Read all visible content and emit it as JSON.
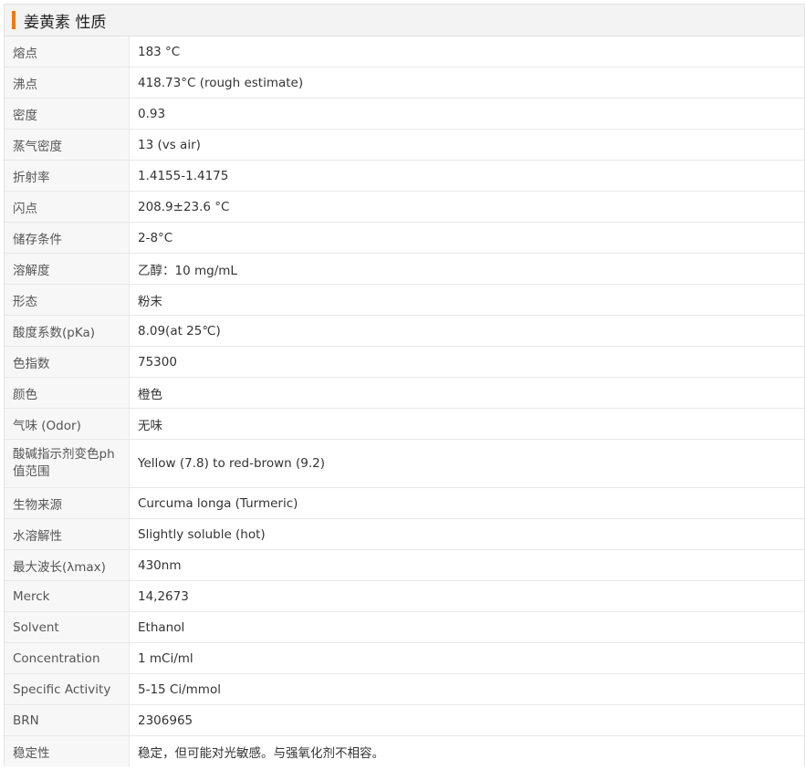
{
  "header": {
    "title": "姜黄素 性质"
  },
  "rows": [
    {
      "label": "熔点",
      "value": "183 °C"
    },
    {
      "label": "沸点",
      "value": "418.73°C (rough estimate)"
    },
    {
      "label": "密度",
      "value": "0.93"
    },
    {
      "label": "蒸气密度",
      "value": "13 (vs air)"
    },
    {
      "label": "折射率",
      "value": "1.4155-1.4175"
    },
    {
      "label": "闪点",
      "value": "208.9±23.6 °C"
    },
    {
      "label": "储存条件",
      "value": "2-8°C"
    },
    {
      "label": "溶解度",
      "value": "乙醇：10 mg/mL"
    },
    {
      "label": "形态",
      "value": "粉末"
    },
    {
      "label": "酸度系数(pKa)",
      "value": "8.09(at 25℃)"
    },
    {
      "label": "色指数",
      "value": "75300"
    },
    {
      "label": "颜色",
      "value": "橙色"
    },
    {
      "label": "气味 (Odor)",
      "value": "无味"
    },
    {
      "label": "酸碱指示剂变色ph值范围",
      "value": "Yellow (7.8) to red-brown (9.2)"
    },
    {
      "label": "生物来源",
      "value": "Curcuma longa (Turmeric)"
    },
    {
      "label": "水溶解性",
      "value": "Slightly soluble (hot)"
    },
    {
      "label": "最大波长(λmax)",
      "value": "430nm"
    },
    {
      "label": "Merck",
      "value": "14,2673"
    },
    {
      "label": "Solvent",
      "value": "Ethanol"
    },
    {
      "label": "Concentration",
      "value": "1 mCi/ml"
    },
    {
      "label": "Specific Activity",
      "value": "5-15 Ci/mmol"
    },
    {
      "label": "BRN",
      "value": "2306965"
    },
    {
      "label": "稳定性",
      "value": "稳定，但可能对光敏感。与强氧化剂不相容。"
    }
  ],
  "colors": {
    "accent": "#f07a12",
    "header_bg": "#f3f3f3",
    "label_bg": "#f7f7f7",
    "border": "#e8e8e8"
  }
}
